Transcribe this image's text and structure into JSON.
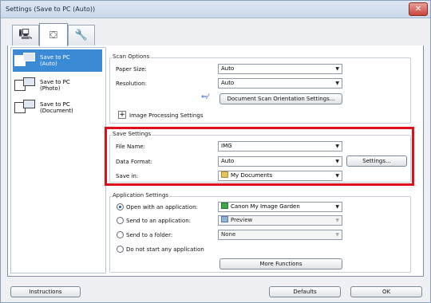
{
  "window": {
    "title": "Settings (Save to PC (Auto))",
    "close_glyph": "✕"
  },
  "tabs": [
    {
      "icon": "scan-from-computer-icon",
      "glyph": "🖳"
    },
    {
      "icon": "scan-from-operation-panel-icon",
      "glyph": "⛋"
    },
    {
      "icon": "general-settings-icon",
      "glyph": "🔧"
    }
  ],
  "sidebar": {
    "items": [
      {
        "label": "Save to PC\n(Auto)",
        "selected": true
      },
      {
        "label": "Save to PC\n(Photo)",
        "selected": false
      },
      {
        "label": "Save to PC\n(Document)",
        "selected": false
      }
    ]
  },
  "scan_options": {
    "title": "Scan Options",
    "paper_size_label": "Paper Size:",
    "paper_size_value": "Auto",
    "resolution_label": "Resolution:",
    "resolution_value": "Auto",
    "orientation_button": "Document Scan Orientation Settings...",
    "image_processing_label": "Image Processing Settings"
  },
  "save_settings": {
    "title": "Save Settings",
    "file_name_label": "File Name:",
    "file_name_value": "IMG",
    "data_format_label": "Data Format:",
    "data_format_value": "Auto",
    "settings_button": "Settings...",
    "save_in_label": "Save in:",
    "save_in_value": "My Documents",
    "highlight_color": "#e0101a"
  },
  "application_settings": {
    "title": "Application Settings",
    "open_with_label": "Open with an application:",
    "open_with_value": "Canon My Image Garden",
    "send_to_app_label": "Send to an application:",
    "send_to_app_value": "Preview",
    "send_to_folder_label": "Send to a folder:",
    "send_to_folder_value": "None",
    "do_not_start_label": "Do not start any application",
    "more_functions_button": "More Functions",
    "selected_option": "open_with"
  },
  "footer": {
    "instructions_button": "Instructions",
    "defaults_button": "Defaults",
    "ok_button": "OK"
  }
}
